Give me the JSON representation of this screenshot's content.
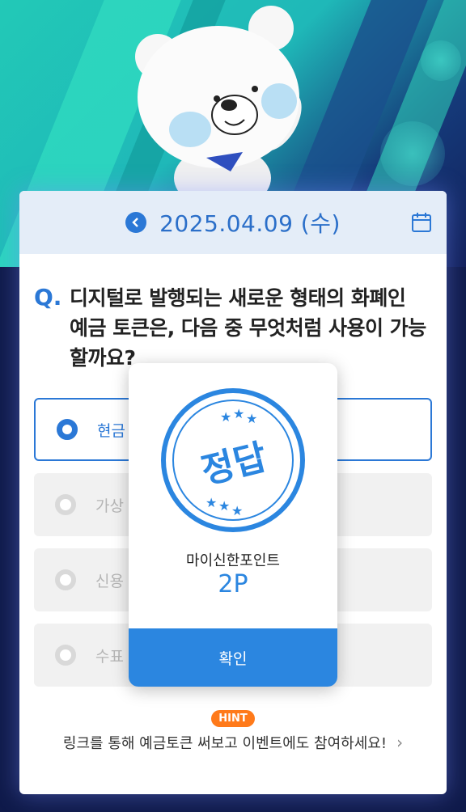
{
  "date_bar": {
    "date": "2025.04.09 (수)"
  },
  "question": {
    "mark": "Q.",
    "text": "디지털로 발행되는 새로운 형태의 화폐인 예금 토큰은, 다음 중 무엇처럼 사용이 가능할까요?"
  },
  "options": [
    {
      "label": "현금",
      "selected": true
    },
    {
      "label": "가상",
      "selected": false
    },
    {
      "label": "신용",
      "selected": false
    },
    {
      "label": "수표",
      "selected": false
    }
  ],
  "hint": {
    "badge": "HINT",
    "text": "링크를 통해 예금토큰 써보고 이벤트에도 참여하세요!"
  },
  "result_popup": {
    "stamp_text": "정답",
    "points_label": "마이신한포인트",
    "points_value": "2P",
    "confirm_label": "확인"
  },
  "colors": {
    "accent": "#2b86e0",
    "hint_badge": "#ff7a1a",
    "date_bar_bg": "#e4edf8"
  },
  "icons": [
    "chevron-left-icon",
    "calendar-icon",
    "chevron-right-icon",
    "radio-icon",
    "bear-mascot"
  ]
}
